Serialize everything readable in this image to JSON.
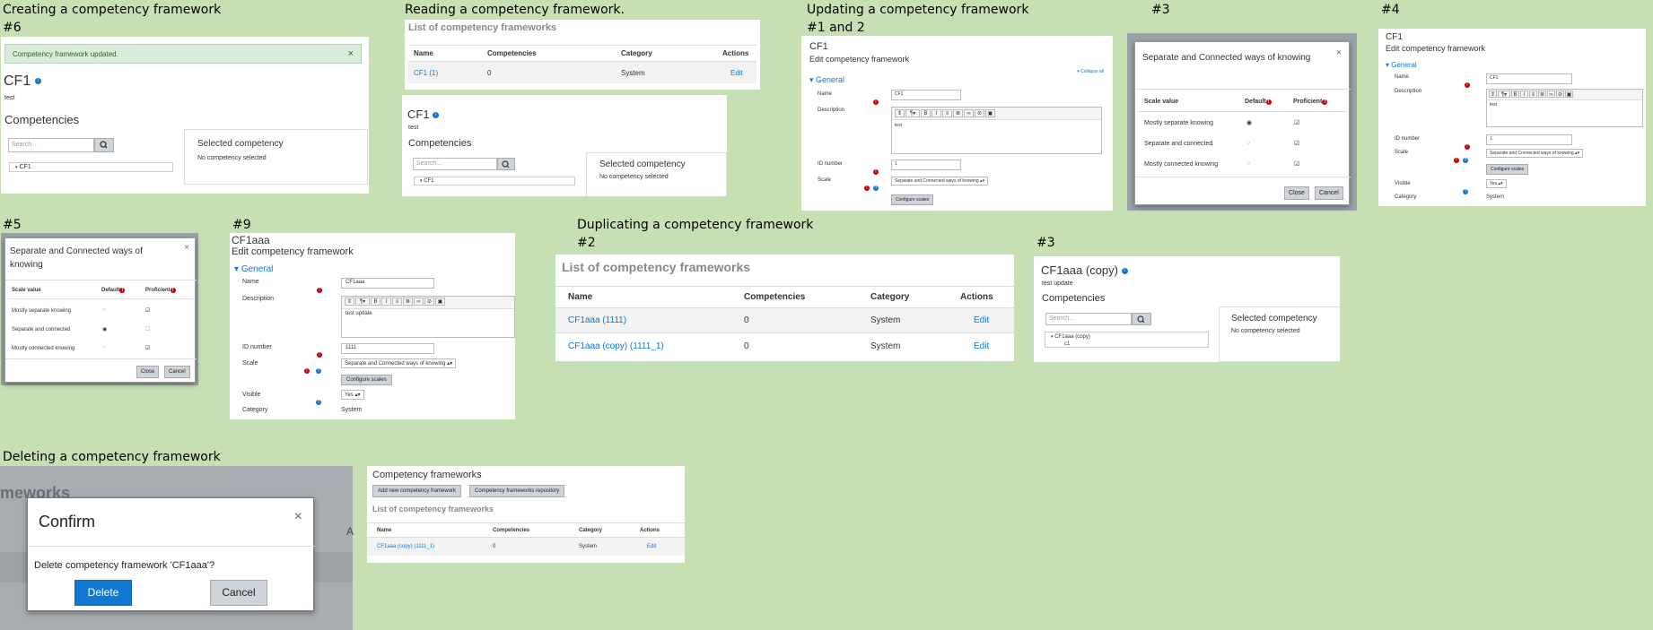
{
  "headings": {
    "creating": "Creating a competency framework",
    "creating_step": "#6",
    "reading": "Reading a competency framework.",
    "updating": "Updating a competency framework",
    "updating_step12": "#1 and 2",
    "updating_step3": "#3",
    "updating_step4": "#4",
    "step5": "#5",
    "step9": "#9",
    "duplicating": "Duplicating a competency framework",
    "dup_step2": "#2",
    "dup_step3": "#3",
    "deleting": "Deleting a competency framework"
  },
  "create_panel": {
    "alert": "Competency framework updated.",
    "close": "×",
    "title": "CF1",
    "desc": "test",
    "competencies": "Competencies",
    "search_placeholder": "Search...",
    "tree_item": "CF1",
    "selected_title": "Selected competency",
    "selected_none": "No competency selected"
  },
  "read_list": {
    "title": "List of competency frameworks",
    "headers": [
      "Name",
      "Competencies",
      "Category",
      "Actions"
    ],
    "row": {
      "name": "CF1 (1)",
      "count": "0",
      "category": "System",
      "action": "Edit"
    }
  },
  "read_detail": {
    "title": "CF1",
    "desc": "test",
    "competencies": "Competencies",
    "search_placeholder": "Search...",
    "tree_item": "CF1",
    "selected_title": "Selected competency",
    "selected_none": "No competency selected"
  },
  "update_form": {
    "title": "CF1",
    "subtitle": "Edit competency framework",
    "collapse_all": "Collapse all",
    "section": "General",
    "name_label": "Name",
    "name_value": "CF1",
    "desc_label": "Description",
    "desc_value": "test",
    "idnum_label": "ID number",
    "idnum_value": "1",
    "scale_label": "Scale",
    "scale_value": "Separate and Connected ways of knowing",
    "configure": "Configure scales"
  },
  "scale_modal_a": {
    "title": "Separate and Connected ways of knowing",
    "headers": [
      "Scale value",
      "Default",
      "Proficient"
    ],
    "rows": [
      "Mostly separate knowing",
      "Separate and connected",
      "Mostly connected knowing"
    ],
    "close": "Close",
    "cancel": "Cancel"
  },
  "edit_form_4": {
    "title": "CF1",
    "subtitle": "Edit competency framework",
    "section": "General",
    "name_label": "Name",
    "name_value": "CF1",
    "desc_label": "Description",
    "desc_value": "test",
    "idnum_label": "ID number",
    "idnum_value": "1",
    "scale_label": "Scale",
    "scale_value": "Separate and Connected ways of knowing",
    "configure": "Configure scales",
    "visible_label": "Visible",
    "visible_value": "Yes",
    "category_label": "Category",
    "category_value": "System"
  },
  "scale_modal_b": {
    "title": "Separate and Connected ways of knowing",
    "headers": [
      "Scale value",
      "Default",
      "Proficient"
    ],
    "rows": [
      "Mostly separate knowing",
      "Separate and connected",
      "Mostly connected knowing"
    ],
    "close": "Close",
    "cancel": "Cancel"
  },
  "edit_form_9": {
    "title": "CF1aaa",
    "subtitle": "Edit competency framework",
    "section": "General",
    "name_label": "Name",
    "name_value": "CF1aaa",
    "desc_label": "Description",
    "desc_value": "test update",
    "idnum_label": "ID number",
    "idnum_value": "1111",
    "scale_label": "Scale",
    "scale_value": "Separate and Connected ways of knowing",
    "configure": "Configure scales",
    "visible_label": "Visible",
    "visible_value": "Yes",
    "category_label": "Category",
    "category_value": "System"
  },
  "dup_list": {
    "title": "List of competency frameworks",
    "headers": [
      "Name",
      "Competencies",
      "Category",
      "Actions"
    ],
    "rows": [
      {
        "name": "CF1aaa (1111)",
        "count": "0",
        "category": "System",
        "action": "Edit"
      },
      {
        "name": "CF1aaa (copy) (1111_1)",
        "count": "0",
        "category": "System",
        "action": "Edit"
      }
    ]
  },
  "dup_detail": {
    "title": "CF1aaa (copy)",
    "desc": "test update",
    "competencies": "Competencies",
    "search_placeholder": "Search...",
    "tree_item": "CF1aaa (copy)",
    "tree_child": "c1",
    "selected_title": "Selected competency",
    "selected_none": "No competency selected"
  },
  "confirm": {
    "bg_text": "meworks",
    "bg_letter": "A",
    "title": "Confirm",
    "close": "×",
    "message": "Delete competency framework 'CF1aaa'?",
    "delete": "Delete",
    "cancel": "Cancel"
  },
  "after_delete": {
    "title": "Competency frameworks",
    "add_btn": "Add new competency framework",
    "repo_btn": "Competency frameworks repository",
    "list_title": "List of competency frameworks",
    "headers": [
      "Name",
      "Competencies",
      "Category",
      "Actions"
    ],
    "row": {
      "name": "CF1aaa (copy) (1111_1)",
      "count": "0",
      "category": "System",
      "action": "Edit"
    }
  }
}
